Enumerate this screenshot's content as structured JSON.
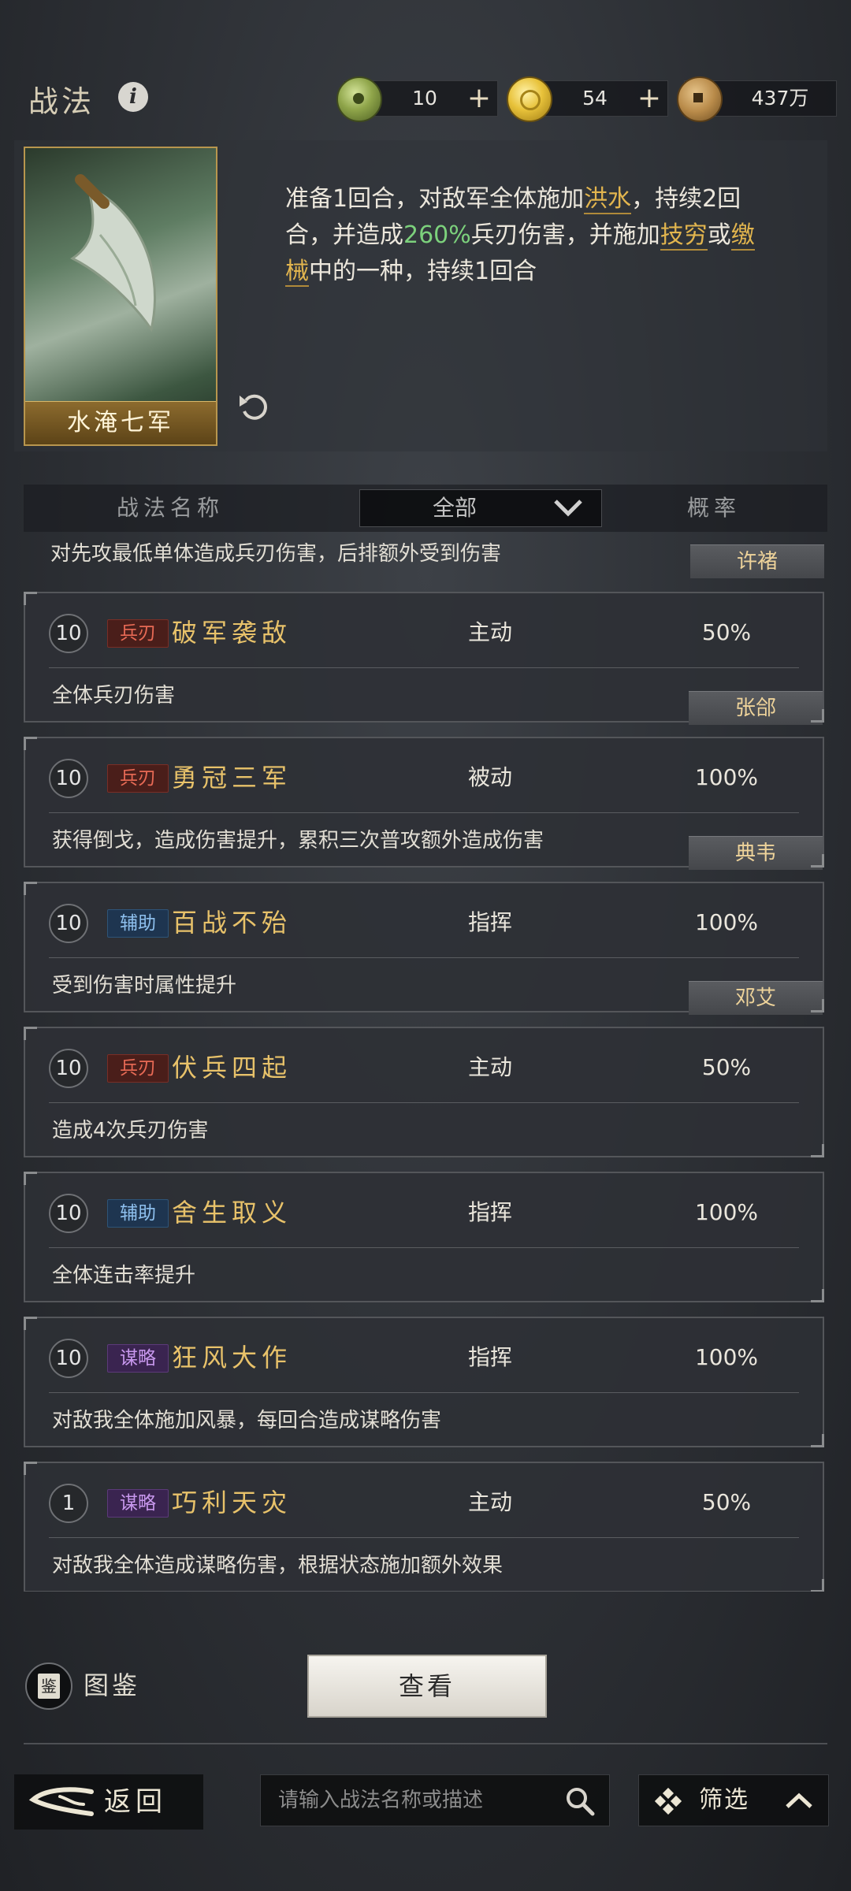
{
  "header": {
    "title": "战法"
  },
  "currencies": [
    {
      "name": "jade",
      "value": "10",
      "plus": "+"
    },
    {
      "name": "gold",
      "value": "54",
      "plus": "+"
    },
    {
      "name": "copper",
      "value": "437万"
    }
  ],
  "detail": {
    "card_name": "水淹七军",
    "desc": {
      "p1": "准备1回合，对敌军全体施加",
      "k1": "洪水",
      "p2": "，持续2回合，并造成",
      "pct": "260%",
      "p3": "兵刃伤害，并施加",
      "k2": "技穷",
      "p4": "或",
      "k3": "缴械",
      "p5": "中的一种，持续1回合"
    }
  },
  "table_header": {
    "name": "战法名称",
    "filter": "全部",
    "rate": "概率"
  },
  "partial_row": {
    "desc": "对先攻最低单体造成兵刃伤害，后排额外受到伤害",
    "hero": "许褚"
  },
  "skills": [
    {
      "level": "10",
      "tag": "兵刃",
      "name": "破军袭敌",
      "type": "主动",
      "rate": "50%",
      "desc": "全体兵刃伤害",
      "hero": "张郃"
    },
    {
      "level": "10",
      "tag": "兵刃",
      "name": "勇冠三军",
      "type": "被动",
      "rate": "100%",
      "desc": "获得倒戈，造成伤害提升，累积三次普攻额外造成伤害",
      "hero": "典韦"
    },
    {
      "level": "10",
      "tag": "辅助",
      "name": "百战不殆",
      "type": "指挥",
      "rate": "100%",
      "desc": "受到伤害时属性提升",
      "hero": "邓艾"
    },
    {
      "level": "10",
      "tag": "兵刃",
      "name": "伏兵四起",
      "type": "主动",
      "rate": "50%",
      "desc": "造成4次兵刃伤害"
    },
    {
      "level": "10",
      "tag": "辅助",
      "name": "舍生取义",
      "type": "指挥",
      "rate": "100%",
      "desc": "全体连击率提升"
    },
    {
      "level": "10",
      "tag": "谋略",
      "name": "狂风大作",
      "type": "指挥",
      "rate": "100%",
      "desc": "对敌我全体施加风暴，每回合造成谋略伤害"
    },
    {
      "level": "1",
      "tag": "谋略",
      "name": "巧利天灾",
      "type": "主动",
      "rate": "50%",
      "desc": "对敌我全体造成谋略伤害，根据状态施加额外效果"
    }
  ],
  "bottom": {
    "tujian_icon_char": "鉴",
    "tujian": "图鉴",
    "view": "查看",
    "back": "返回",
    "search_placeholder": "请输入战法名称或描述",
    "filter": "筛选"
  },
  "colors": {
    "gold_text": "#e8c26a",
    "keyword": "#e2b54e",
    "percent_green": "#7cd17c"
  }
}
